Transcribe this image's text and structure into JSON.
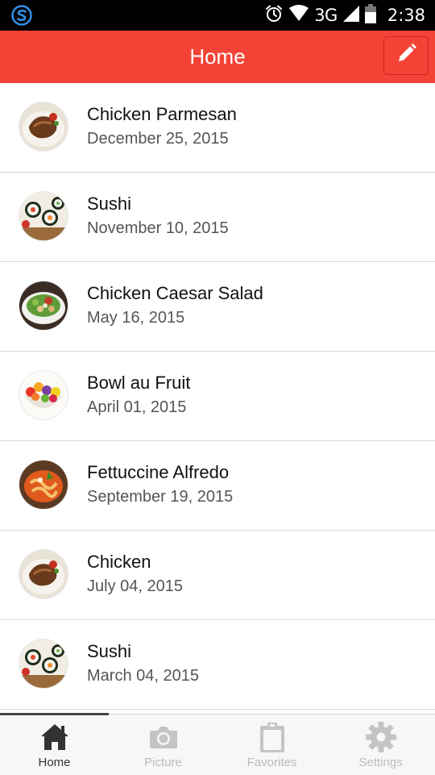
{
  "status_bar": {
    "network": "3G",
    "time": "2:38",
    "icons": [
      "app-s-icon",
      "alarm-icon",
      "wifi-icon",
      "signal-icon",
      "battery-icon"
    ]
  },
  "header": {
    "title": "Home",
    "edit_icon": "pencil-icon",
    "color": "#f44336"
  },
  "recipes": [
    {
      "title": "Chicken Parmesan",
      "date": "December 25, 2015",
      "thumb": "chicken"
    },
    {
      "title": "Sushi",
      "date": "November 10, 2015",
      "thumb": "sushi"
    },
    {
      "title": "Chicken Caesar Salad",
      "date": "May 16, 2015",
      "thumb": "salad"
    },
    {
      "title": "Bowl au Fruit",
      "date": "April 01, 2015",
      "thumb": "fruit"
    },
    {
      "title": "Fettuccine Alfredo",
      "date": "September 19, 2015",
      "thumb": "pasta"
    },
    {
      "title": "Chicken",
      "date": "July 04, 2015",
      "thumb": "chicken"
    },
    {
      "title": "Sushi",
      "date": "March 04, 2015",
      "thumb": "sushi"
    }
  ],
  "tabs": [
    {
      "label": "Home",
      "icon": "home-icon",
      "active": true
    },
    {
      "label": "Picture",
      "icon": "camera-icon",
      "active": false
    },
    {
      "label": "Favorites",
      "icon": "clipboard-icon",
      "active": false
    },
    {
      "label": "Settings",
      "icon": "gear-icon",
      "active": false
    }
  ]
}
